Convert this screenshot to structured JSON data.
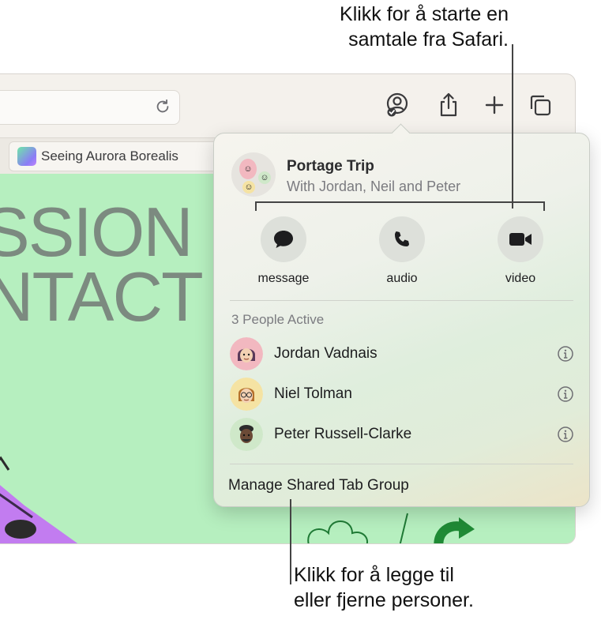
{
  "callouts": {
    "top_line1": "Klikk for å starte en",
    "top_line2": "samtale fra Safari.",
    "bottom_line1": "Klikk for å legge til",
    "bottom_line2": "eller fjerne personer."
  },
  "browser": {
    "tab_title": "Seeing Aurora Borealis",
    "page_text_line1": "SSION",
    "page_text_line2": "NTACT"
  },
  "popover": {
    "group_title": "Portage Trip",
    "group_subtitle": "With Jordan, Neil and Peter",
    "actions": [
      {
        "label": "message",
        "icon": "message-bubble-icon"
      },
      {
        "label": "audio",
        "icon": "phone-icon"
      },
      {
        "label": "video",
        "icon": "video-camera-icon"
      }
    ],
    "section_title": "3 People Active",
    "people": [
      {
        "name": "Jordan Vadnais",
        "avatar_color": "#f2b8c0"
      },
      {
        "name": "Niel Tolman",
        "avatar_color": "#f5e3a3"
      },
      {
        "name": "Peter Russell-Clarke",
        "avatar_color": "#cfe8c9"
      }
    ],
    "manage_label": "Manage Shared Tab Group"
  },
  "colors": {
    "page_background": "#b6efbf",
    "icon_dark": "#3a3a3c"
  }
}
